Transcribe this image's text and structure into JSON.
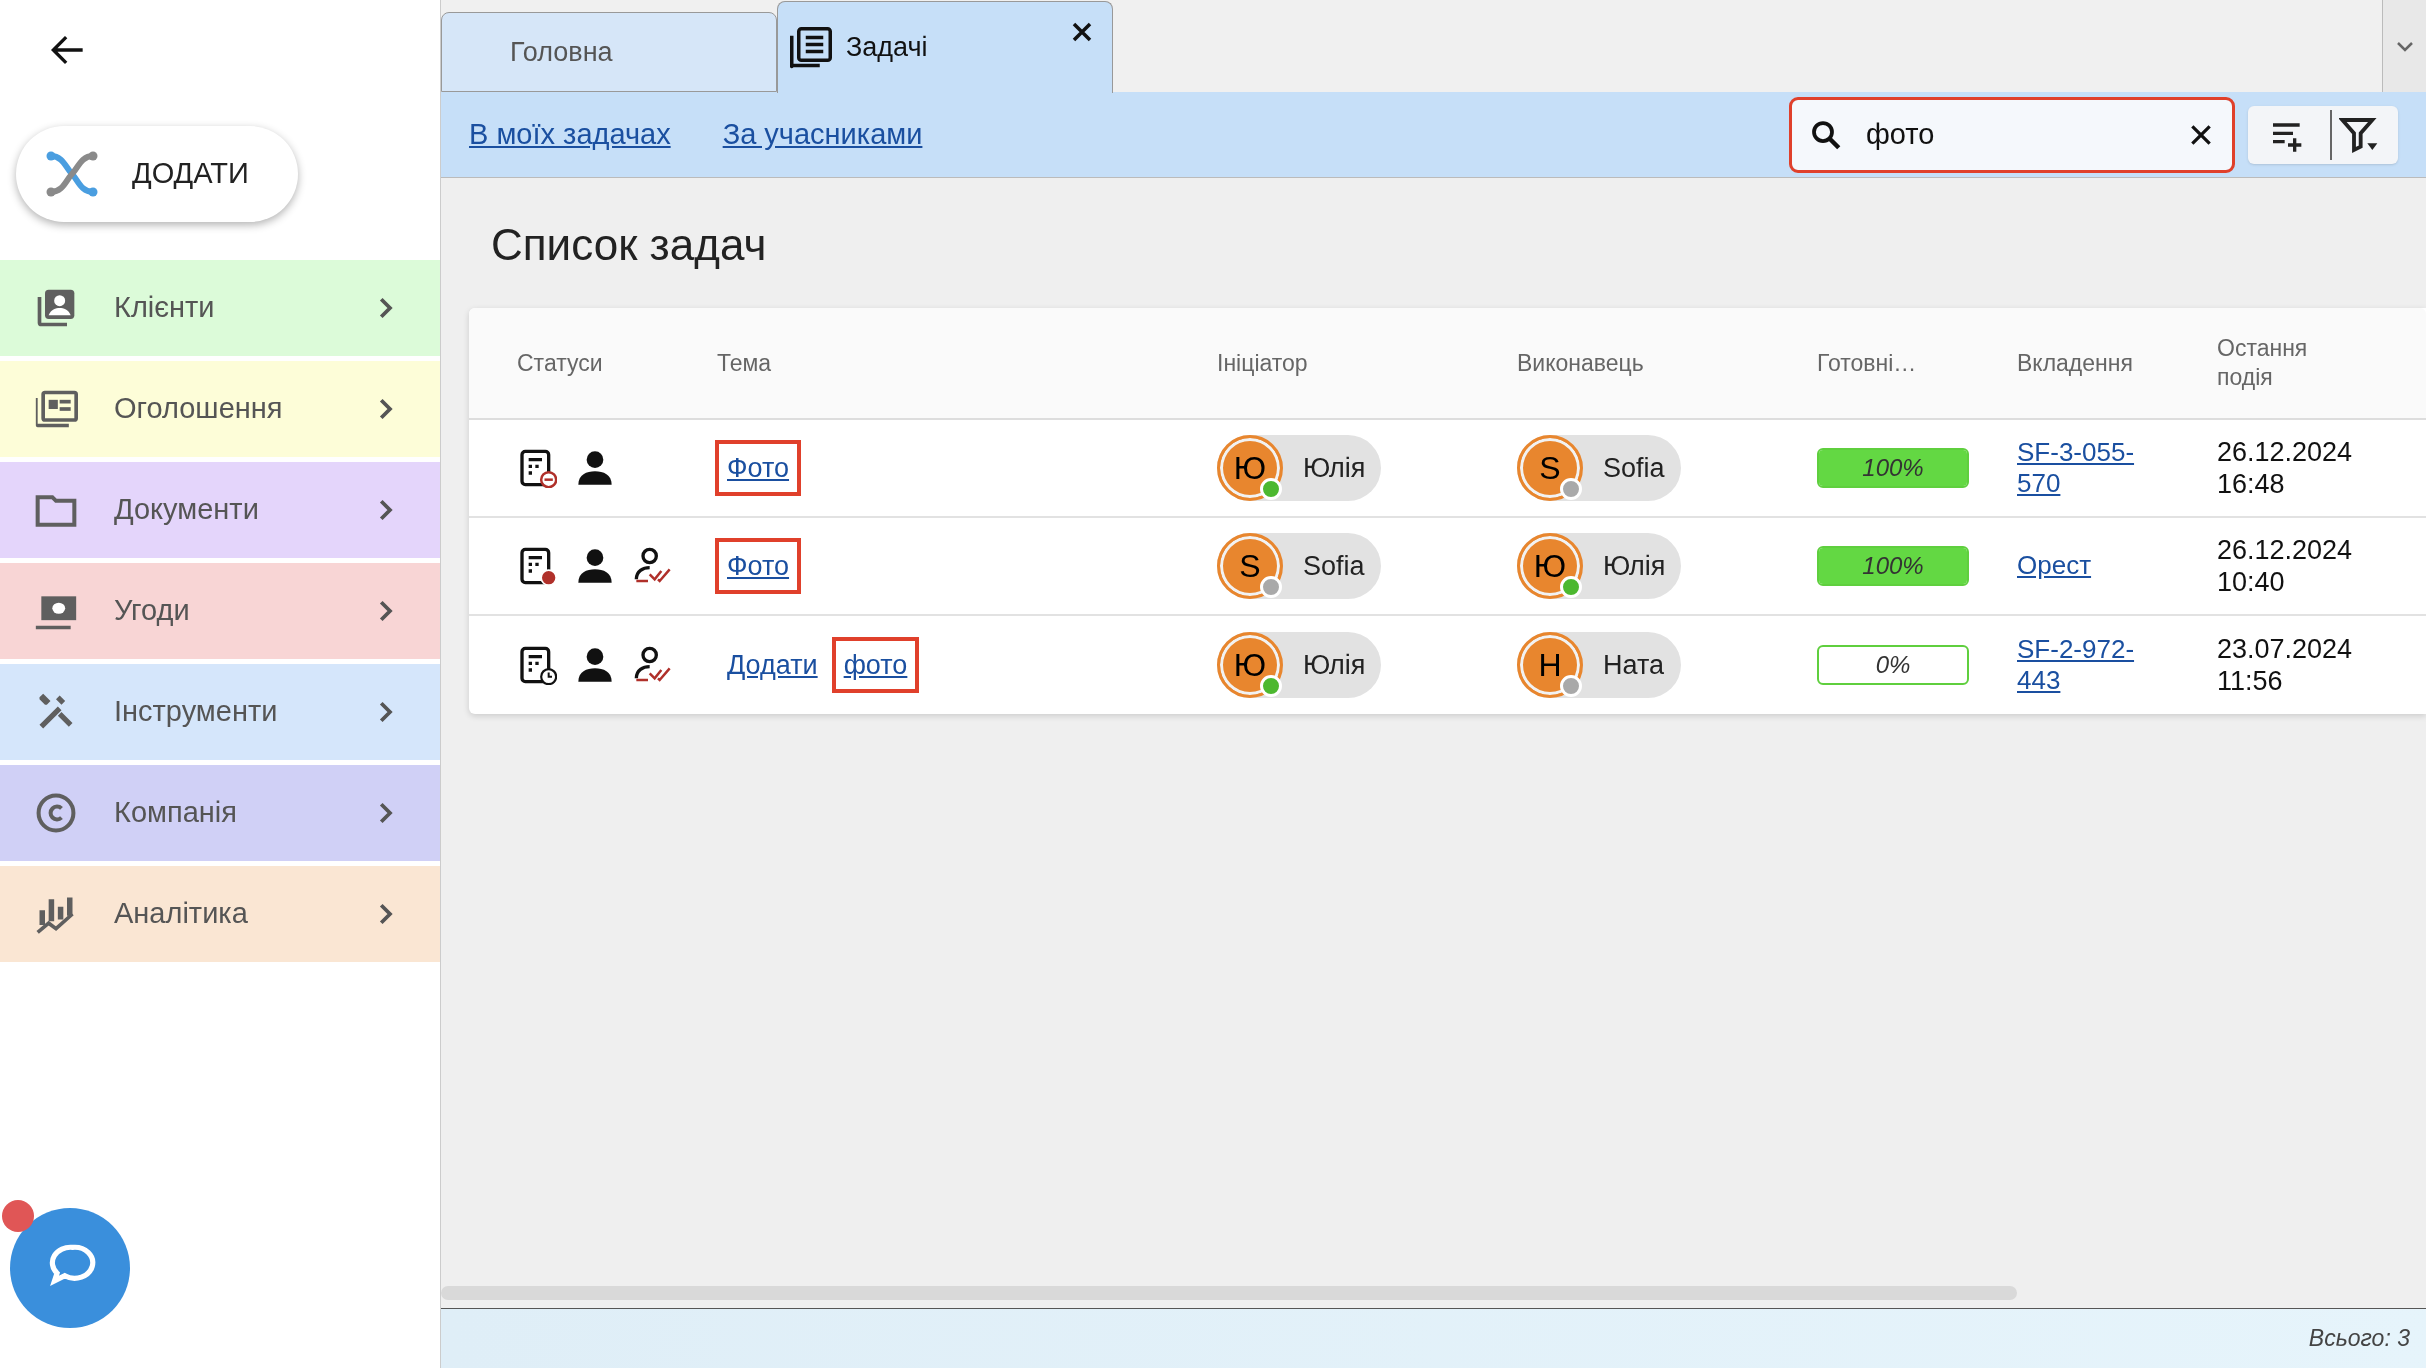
{
  "sidebar": {
    "add_button": "ДОДАТИ",
    "items": [
      {
        "label": "Клієнти",
        "kind": "contacts",
        "color": "#dcfbd9"
      },
      {
        "label": "Оголошення",
        "kind": "listing",
        "color": "#fdfdd8"
      },
      {
        "label": "Документи",
        "kind": "folder",
        "color": "#e4d5fb"
      },
      {
        "label": "Угоди",
        "kind": "money",
        "color": "#f8d5d5"
      },
      {
        "label": "Інструменти",
        "kind": "tools",
        "color": "#d5e6fb"
      },
      {
        "label": "Компанія",
        "kind": "copyright",
        "color": "#d0d0f6"
      },
      {
        "label": "Аналітика",
        "kind": "chart",
        "color": "#fae6d3"
      }
    ],
    "chat_unread": true
  },
  "tabs": [
    {
      "label": "Головна",
      "selected": false,
      "closable": false
    },
    {
      "label": "Задачі",
      "selected": true,
      "closable": true
    }
  ],
  "toolbar": {
    "links": [
      "В моїх задачах",
      "За учасниками"
    ],
    "search": {
      "value": "фото",
      "highlighted": true
    }
  },
  "page_title": "Список задач",
  "table": {
    "columns": [
      "Статуси",
      "Тема",
      "Ініціатор",
      "Виконавець",
      "Готовні…",
      "Вкладення",
      "Остання подія"
    ],
    "rows": [
      {
        "statuses": [
          {
            "kind": "doc-minus"
          },
          {
            "kind": "person"
          }
        ],
        "topic": [
          {
            "text": "Фото",
            "highlighted": true
          }
        ],
        "initiator": {
          "initial": "Ю",
          "name": "Юлія",
          "online": true
        },
        "executor": {
          "initial": "S",
          "name": "Sofia",
          "online": false
        },
        "progress": {
          "level": 1,
          "text": "100%"
        },
        "attachment": "SF-3-055-570",
        "date": "26.12.2024",
        "time": "16:48"
      },
      {
        "statuses": [
          {
            "kind": "doc-overdue"
          },
          {
            "kind": "person"
          },
          {
            "kind": "person-check"
          }
        ],
        "topic": [
          {
            "text": "Фото",
            "highlighted": true
          }
        ],
        "initiator": {
          "initial": "S",
          "name": "Sofia",
          "online": false
        },
        "executor": {
          "initial": "Ю",
          "name": "Юлія",
          "online": true
        },
        "progress": {
          "level": 1,
          "text": "100%"
        },
        "attachment": "Орест",
        "date": "26.12.2024",
        "time": "10:40"
      },
      {
        "statuses": [
          {
            "kind": "doc-clock"
          },
          {
            "kind": "person"
          },
          {
            "kind": "person-check"
          }
        ],
        "topic": [
          {
            "text": "Додати",
            "highlighted": false
          },
          {
            "text": "фото",
            "highlighted": true
          }
        ],
        "initiator": {
          "initial": "Ю",
          "name": "Юлія",
          "online": true
        },
        "executor": {
          "initial": "Н",
          "name": "Ната",
          "online": false
        },
        "progress": {
          "level": 0,
          "text": "0%"
        },
        "attachment": "SF-2-972-443",
        "date": "23.07.2024",
        "time": "11:56"
      }
    ]
  },
  "footer": {
    "total": "Всього: 3"
  }
}
